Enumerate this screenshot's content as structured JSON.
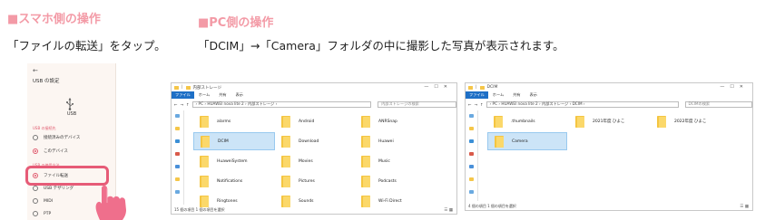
{
  "left": {
    "heading": "■スマホ側の操作",
    "caption": "「ファイルの転送」をタップ。",
    "phone": {
      "back_arrow": "←",
      "title": "USB の設定",
      "usb_label": "USB",
      "section_connection": "USB の接続先",
      "section_usage": "USB の使用方法",
      "options": [
        {
          "label": "接続済みのデバイス",
          "selected": false
        },
        {
          "label": "このデバイス",
          "selected": true
        },
        {
          "label": "ファイル転送",
          "selected": true
        },
        {
          "label": "USB テザリング",
          "selected": false
        },
        {
          "label": "MIDI",
          "selected": false
        },
        {
          "label": "PTP",
          "selected": false
        }
      ]
    },
    "colors": {
      "accent": "#e65b77",
      "heading": "#f39aa6"
    }
  },
  "right": {
    "heading": "■PC側の操作",
    "caption": "「DCIM」→「Camera」フォルダの中に撮影した写真が表示されます。"
  },
  "window1": {
    "title": "内部ストレージ",
    "tabs": [
      "ファイル",
      "ホーム",
      "共有",
      "表示"
    ],
    "path": "›  PC  ›  HUAWEI nova lite 2  ›  内部ストレージ  ›",
    "search_placeholder": "内部ストレージの検索",
    "items": [
      {
        "name": "alarms",
        "selected": false
      },
      {
        "name": "Android",
        "selected": false
      },
      {
        "name": "ANRSnap",
        "selected": false
      },
      {
        "name": "DCIM",
        "selected": true
      },
      {
        "name": "Download",
        "selected": false
      },
      {
        "name": "Huawei",
        "selected": false
      },
      {
        "name": "HuaweiSystem",
        "selected": false
      },
      {
        "name": "Movies",
        "selected": false
      },
      {
        "name": "Music",
        "selected": false
      },
      {
        "name": "Notifications",
        "selected": false
      },
      {
        "name": "Pictures",
        "selected": false
      },
      {
        "name": "Podcasts",
        "selected": false
      },
      {
        "name": "Ringtones",
        "selected": false
      },
      {
        "name": "Sounds",
        "selected": false
      },
      {
        "name": "Wi-Fi Direct",
        "selected": false
      }
    ],
    "status": "15 個の項目    1 個の項目を選択"
  },
  "window2": {
    "title": "DCIM",
    "tabs": [
      "ファイル",
      "ホーム",
      "共有",
      "表示"
    ],
    "path": "›  PC  ›  HUAWEI nova lite 2  ›  内部ストレージ  ›  DCIM  ›",
    "search_placeholder": "DCIMの検索",
    "items": [
      {
        "name": ".thumbnails",
        "selected": false
      },
      {
        "name": "2021年度 ひよこ",
        "selected": false
      },
      {
        "name": "2022年度 ひよこ",
        "selected": false
      },
      {
        "name": "Camera",
        "selected": true
      }
    ],
    "status": "4 個の項目    1 個の項目を選択"
  }
}
